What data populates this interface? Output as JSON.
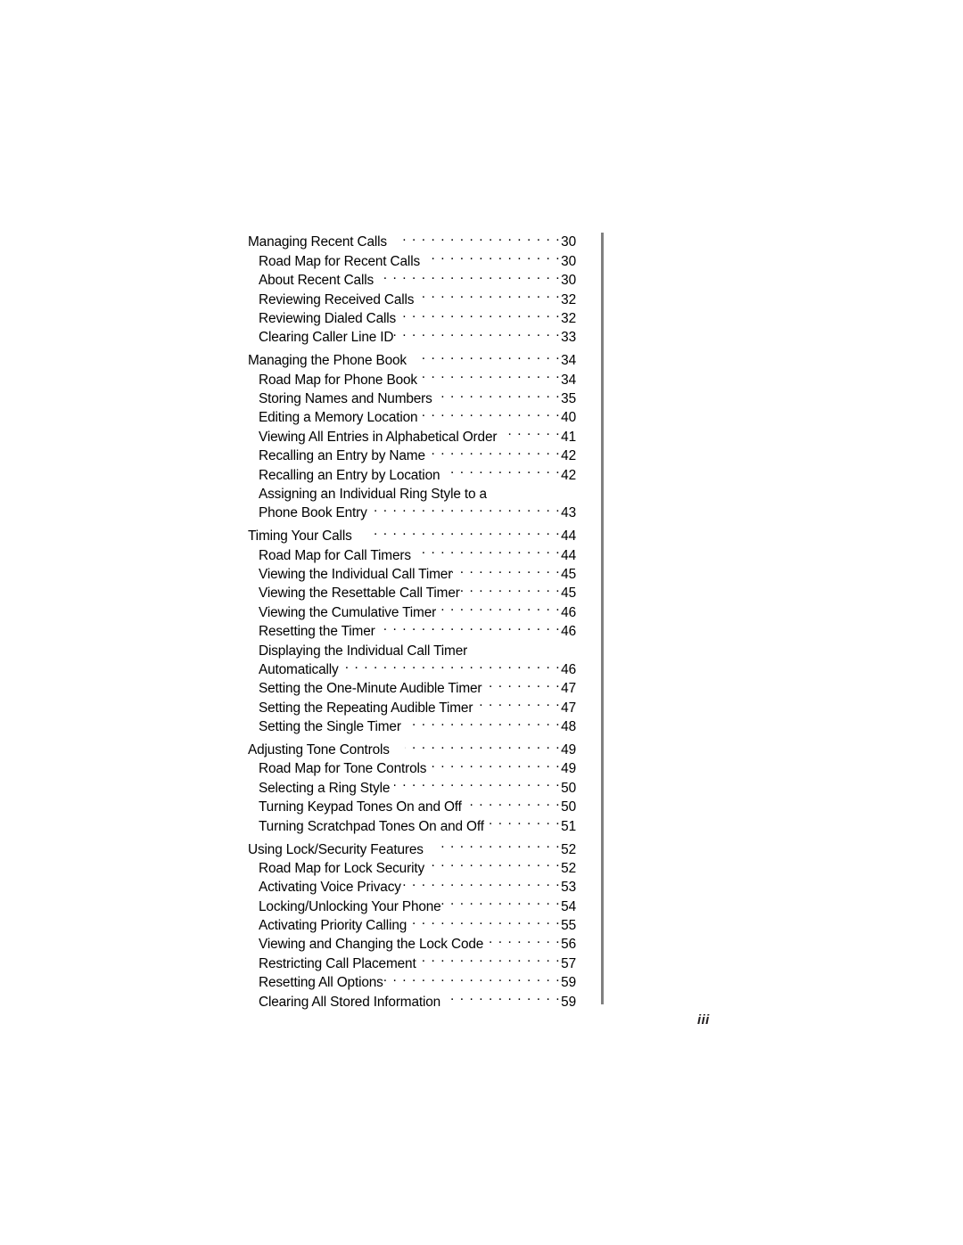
{
  "document": {
    "folio": "iii"
  },
  "toc": {
    "entries": [
      {
        "level": 1,
        "title": "Managing Recent Calls",
        "page": "30",
        "section_start": false
      },
      {
        "level": 2,
        "title": "Road Map for Recent Calls",
        "page": "30",
        "section_start": false
      },
      {
        "level": 2,
        "title": "About Recent Calls",
        "page": "30",
        "section_start": false
      },
      {
        "level": 2,
        "title": "Reviewing Received Calls",
        "page": "32",
        "section_start": false
      },
      {
        "level": 2,
        "title": "Reviewing Dialed Calls",
        "page": "32",
        "section_start": false
      },
      {
        "level": 2,
        "title": "Clearing Caller Line ID",
        "page": "33",
        "section_start": false
      },
      {
        "level": 1,
        "title": "Managing the Phone Book",
        "page": "34",
        "section_start": true
      },
      {
        "level": 2,
        "title": "Road Map for Phone Book",
        "page": "34",
        "section_start": false
      },
      {
        "level": 2,
        "title": "Storing Names and Numbers",
        "page": "35",
        "section_start": false
      },
      {
        "level": 2,
        "title": "Editing a Memory Location",
        "page": "40",
        "section_start": false
      },
      {
        "level": 2,
        "title": "Viewing All Entries in Alphabetical Order",
        "page": "41",
        "section_start": false
      },
      {
        "level": 2,
        "title": "Recalling an Entry by Name",
        "page": "42",
        "section_start": false
      },
      {
        "level": 2,
        "title": "Recalling an Entry by Location",
        "page": "42",
        "section_start": false
      },
      {
        "level": 2,
        "title": "Assigning an Individual Ring Style to a",
        "page": "",
        "section_start": false,
        "wrapped_first": true
      },
      {
        "level": 2,
        "title": "Phone Book Entry",
        "page": "43",
        "section_start": false
      },
      {
        "level": 1,
        "title": "Timing Your Calls",
        "page": "44",
        "section_start": true
      },
      {
        "level": 2,
        "title": "Road Map for Call Timers",
        "page": "44",
        "section_start": false
      },
      {
        "level": 2,
        "title": "Viewing the Individual Call Timer",
        "page": "45",
        "section_start": false
      },
      {
        "level": 2,
        "title": "Viewing the Resettable Call Timer",
        "page": "45",
        "section_start": false
      },
      {
        "level": 2,
        "title": "Viewing the Cumulative Timer",
        "page": "46",
        "section_start": false
      },
      {
        "level": 2,
        "title": "Resetting the Timer",
        "page": "46",
        "section_start": false
      },
      {
        "level": 2,
        "title": "Displaying the Individual Call Timer",
        "page": "",
        "section_start": false,
        "wrapped_first": true
      },
      {
        "level": 2,
        "title": "Automatically",
        "page": "46",
        "section_start": false
      },
      {
        "level": 2,
        "title": "Setting the One-Minute Audible Timer",
        "page": "47",
        "section_start": false
      },
      {
        "level": 2,
        "title": "Setting the Repeating Audible Timer",
        "page": "47",
        "section_start": false
      },
      {
        "level": 2,
        "title": "Setting the Single Timer",
        "page": "48",
        "section_start": false
      },
      {
        "level": 1,
        "title": "Adjusting Tone Controls",
        "page": "49",
        "section_start": true
      },
      {
        "level": 2,
        "title": "Road Map for Tone Controls",
        "page": "49",
        "section_start": false
      },
      {
        "level": 2,
        "title": "Selecting a Ring Style",
        "page": "50",
        "section_start": false
      },
      {
        "level": 2,
        "title": "Turning Keypad Tones On and Off",
        "page": "50",
        "section_start": false
      },
      {
        "level": 2,
        "title": "Turning Scratchpad Tones On and Off",
        "page": "51",
        "section_start": false
      },
      {
        "level": 1,
        "title": "Using Lock/Security Features",
        "page": "52",
        "section_start": true
      },
      {
        "level": 2,
        "title": "Road Map for Lock Security",
        "page": "52",
        "section_start": false
      },
      {
        "level": 2,
        "title": "Activating Voice Privacy",
        "page": "53",
        "section_start": false
      },
      {
        "level": 2,
        "title": "Locking/Unlocking Your Phone",
        "page": "54",
        "section_start": false
      },
      {
        "level": 2,
        "title": "Activating Priority Calling",
        "page": "55",
        "section_start": false
      },
      {
        "level": 2,
        "title": "Viewing and Changing the Lock Code",
        "page": "56",
        "section_start": false
      },
      {
        "level": 2,
        "title": "Restricting Call Placement",
        "page": "57",
        "section_start": false
      },
      {
        "level": 2,
        "title": "Resetting All Options",
        "page": "59",
        "section_start": false
      },
      {
        "level": 2,
        "title": "Clearing All Stored Information",
        "page": "59",
        "section_start": false
      }
    ]
  },
  "colors": {
    "text": "#000000",
    "rule": "#808080",
    "page_background": "#ffffff"
  }
}
